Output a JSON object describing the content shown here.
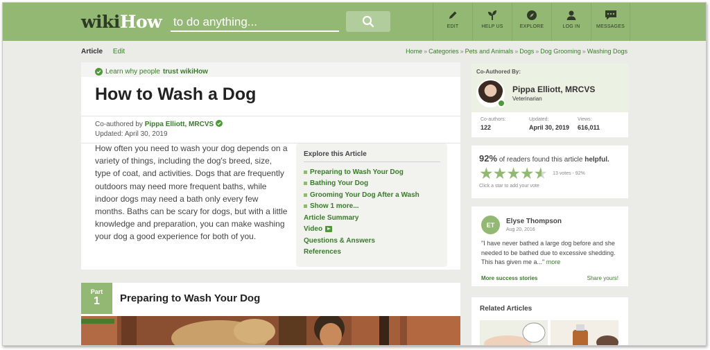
{
  "header": {
    "logo_part1": "wiki",
    "logo_part2": "How",
    "search_placeholder": "to do anything...",
    "nav": [
      {
        "label": "EDIT",
        "icon": "pencil-icon"
      },
      {
        "label": "HELP US",
        "icon": "sprout-icon"
      },
      {
        "label": "EXPLORE",
        "icon": "compass-icon"
      },
      {
        "label": "LOG IN",
        "icon": "user-icon"
      },
      {
        "label": "MESSAGES",
        "icon": "chat-icon"
      }
    ]
  },
  "subnav": {
    "tab_article": "Article",
    "tab_edit": "Edit",
    "breadcrumbs": [
      "Home",
      "Categories",
      "Pets and Animals",
      "Dogs",
      "Dog Grooming",
      "Washing Dogs"
    ],
    "separator": "»"
  },
  "article": {
    "trust_prefix": "Learn why people",
    "trust_bold": "trust wikiHow",
    "title": "How to Wash a Dog",
    "coauthored_label": "Co-authored by",
    "author": "Pippa Elliott, MRCVS",
    "updated": "Updated: April 30, 2019",
    "intro": "How often you need to wash your dog depends on a variety of things, including the dog's breed, size, type of coat, and activities. Dogs that are frequently outdoors may need more frequent baths, while indoor dogs may need a bath only every few months. Baths can be scary for dogs, but with a little knowledge and preparation, you can make washing your dog a good experience for both of you.",
    "toc": {
      "heading": "Explore this Article",
      "items": [
        {
          "label": "Preparing to Wash Your Dog",
          "bullet": true
        },
        {
          "label": "Bathing Your Dog",
          "bullet": true
        },
        {
          "label": "Grooming Your Dog After a Wash",
          "bullet": true
        },
        {
          "label": "Show 1 more...",
          "bullet": true
        },
        {
          "label": "Article Summary",
          "bullet": false
        },
        {
          "label": "Video",
          "bullet": false
        },
        {
          "label": "Questions & Answers",
          "bullet": false
        },
        {
          "label": "References",
          "bullet": false
        }
      ]
    },
    "part": {
      "label": "Part",
      "number": "1",
      "title": "Preparing to Wash Your Dog"
    }
  },
  "sidebar": {
    "coauthor": {
      "label": "Co-Authored By:",
      "name": "Pippa Elliott, MRCVS",
      "role": "Veterinarian",
      "stats": [
        {
          "label": "Co-authors:",
          "value": "122"
        },
        {
          "label": "Updated:",
          "value": "April 30, 2019"
        },
        {
          "label": "Views:",
          "value": "616,011"
        }
      ]
    },
    "rating": {
      "percent": "92%",
      "text_mid": "of readers found this article",
      "text_bold": "helpful.",
      "stars": 4.5,
      "votes": "13 votes - 92%",
      "hint": "Click a star to add your vote"
    },
    "review": {
      "initials": "ET",
      "name": "Elyse Thompson",
      "date": "Aug 20, 2016",
      "quote": "\"I have never bathed a large dog before and she needed to be bathed due to excessive shedding. This has given me a...\"",
      "more": "more",
      "link_left": "More success stories",
      "link_right": "Share yours!"
    },
    "related": {
      "heading": "Related Articles"
    }
  },
  "colors": {
    "brand_green": "#93b874",
    "link_green": "#3a7a2c"
  }
}
